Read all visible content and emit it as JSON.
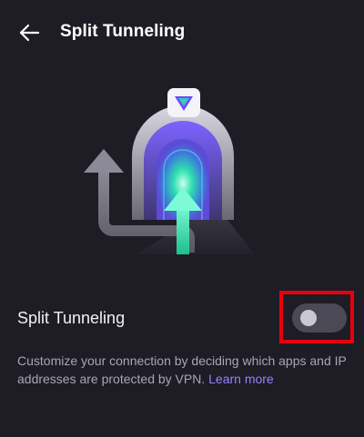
{
  "header": {
    "title": "Split Tunneling"
  },
  "split_tunneling": {
    "label": "Split Tunneling",
    "enabled": false
  },
  "description": {
    "text": "Customize your connection by deciding which apps and IP addresses are protected by VPN.",
    "link_label": "Learn more"
  },
  "colors": {
    "background": "#1e1c25",
    "accent": "#8f86ff",
    "highlight": "#e8000d"
  },
  "icons": {
    "back": "arrow-left-icon",
    "brand": "proton-vpn-logo-icon"
  }
}
